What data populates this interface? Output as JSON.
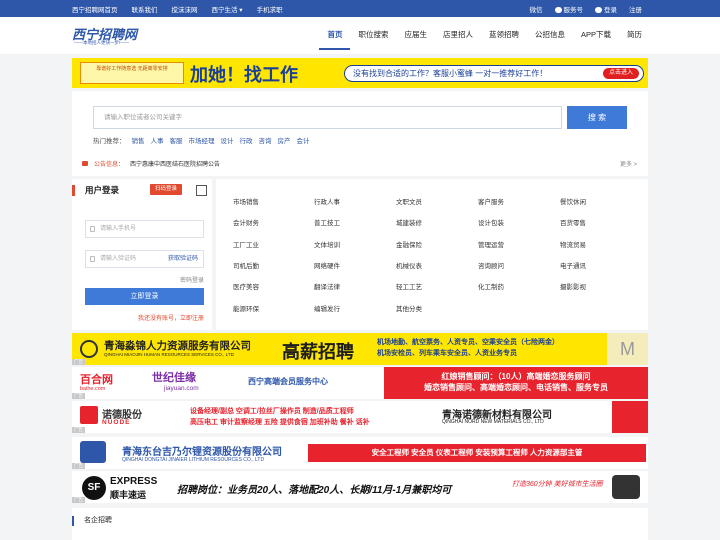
{
  "topbar": {
    "left_links": [
      "西宁招聘网首页",
      "联系我们",
      "搅沫沫网",
      "西宁生活",
      "手机求职"
    ],
    "right": {
      "wechat": "微信",
      "service": "服务号",
      "login": "登录",
      "register": "注册"
    }
  },
  "header": {
    "logo_text": "西宁招聘网",
    "logo_slogan": "——本地招人更快一步!——",
    "nav": [
      "首页",
      "职位搜索",
      "应届生",
      "店里招人",
      "蓝领招聘",
      "公招信息",
      "APP下载",
      "简历"
    ],
    "active_nav": "首页"
  },
  "banner_top": {
    "left_text": "靠谱好工作随意选 无距离零安排",
    "headline": "加她！找工作",
    "question": "没有找到合适的工作？客服小蜜蜂 一对一推荐好工作！",
    "button": "点击进入"
  },
  "search": {
    "placeholder": "请输入职位或者公司关键字",
    "button": "搜 索",
    "hot_label": "热门推荐：",
    "hot_keywords": [
      "销售",
      "人事",
      "客服",
      "市场经理",
      "设计",
      "行政",
      "咨询",
      "房产",
      "会计"
    ],
    "notice_label": "公告信息：",
    "notice_text": "西宁惠康中西医结石医院招聘公告",
    "more": "更多 >"
  },
  "login": {
    "title": "用户登录",
    "register_button": "扫码登录",
    "phone_placeholder": "请输入手机号",
    "code_placeholder": "请输入验证码",
    "get_code": "获取验证码",
    "password_login": "密码登录",
    "login_button": "立即登录",
    "register_link": "我还没有账号，立即注册"
  },
  "categories": [
    [
      "市场销售",
      "行政人事",
      "文职文员",
      "客户服务",
      "餐饮休闲"
    ],
    [
      "会计财务",
      "普工技工",
      "城建装修",
      "设计包装",
      "百货零售"
    ],
    [
      "工厂工业",
      "文体培训",
      "金融保险",
      "管理运营",
      "物流贸易"
    ],
    [
      "司机后勤",
      "网络硬件",
      "机械仪表",
      "咨询顾问",
      "电子通讯"
    ],
    [
      "医疗美容",
      "翻译法律",
      "轻工工艺",
      "化工制药",
      "摄影影视"
    ],
    [
      "能源环保",
      "编辑发行",
      "其他分类",
      "",
      ""
    ]
  ],
  "ads": {
    "tag": "广告",
    "ad1": {
      "company": "青海淼锦人力资源服务有限公司",
      "company_en": "QINGHAI MIAOJIN HUMAN RESOURCES SERVICES CO., LTD",
      "headline": "高薪招聘",
      "line1": "机场地勤、航空票务、人资专员、空乘安全员（七险两金）",
      "line2": "机场安检员、列车乘车安全员、人资业务专员"
    },
    "ad2": {
      "baihe": "百合网",
      "baihe_url": "baihe.com",
      "jiayuan": "世纪佳缘",
      "jiayuan_url": "jiayuan.com",
      "service": "西宁高端会员服务中心",
      "red_line1": "红娘销售顾问：（10人）高端婚恋服务顾问",
      "red_line2": "婚恋销售顾问、高端婚恋顾问、电话销售、服务专员"
    },
    "ad3": {
      "company": "诺德股份",
      "company_en": "NUODE",
      "pos_line1": "设备经理/副总  空调工/拉丝厂操作员  制造/品质工程师",
      "pos_line2": "高压电工  审计监察经理  五险  提供食宿 加班补助 餐补 话补",
      "company2": "青海诺德新材料有限公司",
      "company2_en": "QINGHAI NORD NEW MATERIALS CO., LTD"
    },
    "ad4": {
      "company": "青海东台吉乃尔锂资源股份有限公司",
      "company_en": "QINGHAI DONGTAI JINAIER LITHIUM RESOURCES CO., LTD",
      "jobs": "安全工程师  安全员  仪表工程师  安装预算工程师  人力资源部主管"
    },
    "ad5": {
      "logo": "SF",
      "name_en": "EXPRESS",
      "name_cn": "顺丰速运",
      "job": "招聘岗位：业务员20人、落地配20人、长期/11月-1月兼职均可",
      "slogan": "打造360分钟 美好城市生活圈"
    }
  },
  "famous": {
    "title": "名企招聘"
  }
}
